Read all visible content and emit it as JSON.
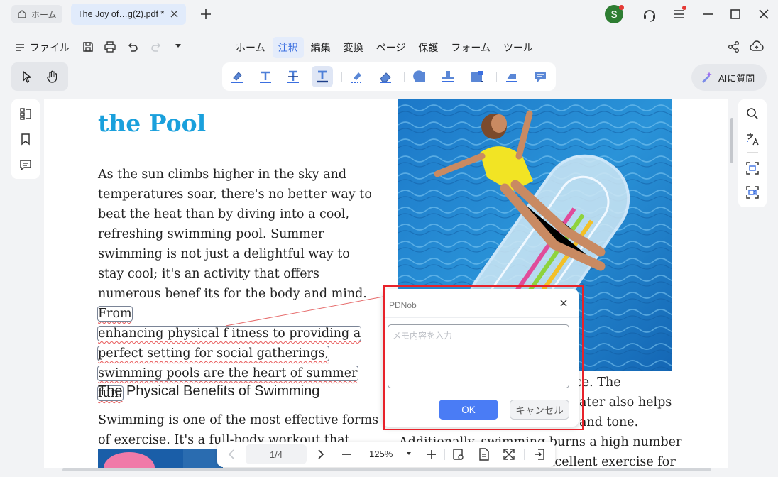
{
  "titlebar": {
    "home_tab_label": "ホーム",
    "doc_tab_label": "The Joy of…g(2).pdf *",
    "avatar_letter": "S"
  },
  "menubar": {
    "file_label": "ファイル",
    "tabs": [
      {
        "label": "ホーム"
      },
      {
        "label": "注釈",
        "active": true
      },
      {
        "label": "編集"
      },
      {
        "label": "変換"
      },
      {
        "label": "ページ"
      },
      {
        "label": "保護"
      },
      {
        "label": "フォーム"
      },
      {
        "label": "ツール"
      }
    ]
  },
  "toolbar": {
    "ai_label": "AIに質問",
    "annotation_tools": [
      "highlight-icon",
      "text-box-icon",
      "strikethrough-icon",
      "underline-icon",
      "area-highlight-icon",
      "eraser-icon",
      "shape-icon",
      "stamp-icon",
      "attachment-icon",
      "note-icon",
      "comment-icon"
    ],
    "accent_color": "#3b6fe0"
  },
  "document": {
    "title": "the Pool",
    "para1_before": "As the sun climbs higher in the sky and temperatures soar, there's no better way to beat the heat than by diving into a cool, refreshing swimming pool. Summer swimming is not just a delightful way to stay cool; it's an activity that offers numerous benef its for the body and mind. ",
    "para1_hl1": "From",
    "para1_hl2": "enhancing physical f itness to providing a",
    "para1_hl3": "perfect setting for social gatherings,",
    "para1_hl4": "swimming pools are the heart of summer fun.",
    "section_heading": "The Physical Benefits of Swimming",
    "para2": "Swimming is one of the most effective forms of exercise. It's a full-body workout that",
    "right_line1": "ce. The",
    "right_line2": "ater also helps",
    "right_line3": "and tone.",
    "right_line4": "Additionally, swimming burns a high number",
    "right_line5": "an excellent exercise for",
    "title_color": "#1aa0dc"
  },
  "note_popup": {
    "title": "PDNob",
    "placeholder": "メモ内容を入力",
    "value": "",
    "ok_label": "OK",
    "cancel_label": "キャンセル"
  },
  "bottom_nav": {
    "page_indicator": "1/4",
    "zoom_level": "125%"
  }
}
